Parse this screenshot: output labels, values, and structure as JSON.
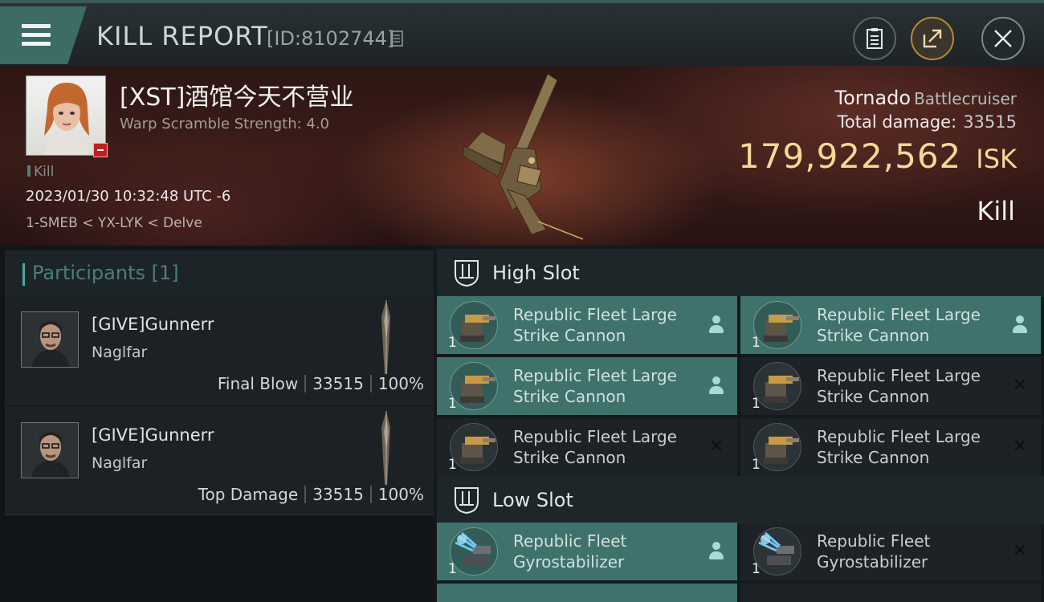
{
  "header": {
    "title": "KILL REPORT",
    "report_id": "[ID:8102744]",
    "buttons": [
      "clipboard-icon",
      "share-icon",
      "close-icon"
    ]
  },
  "victim": {
    "name": "[XST]酒馆今天不营业",
    "scramble": "Warp Scramble Strength: 4.0",
    "tag": "Kill",
    "datetime": "2023/01/30 10:32:48 UTC -6",
    "location": "1-SMEB < YX-LYK < Delve"
  },
  "ship": {
    "name": "Tornado",
    "class": "Battlecruiser",
    "damage_label": "Total damage:",
    "damage_value": "33515",
    "isk_value": "179,922,562",
    "isk_unit": "ISK",
    "result": "Kill"
  },
  "participants": {
    "label": "Participants",
    "count": "[1]",
    "items": [
      {
        "name": "[GIVE]Gunnerr",
        "ship": "Naglfar",
        "role": "Final Blow",
        "damage": "33515",
        "percent": "100%"
      },
      {
        "name": "[GIVE]Gunnerr",
        "ship": "Naglfar",
        "role": "Top Damage",
        "damage": "33515",
        "percent": "100%"
      }
    ]
  },
  "high_slot": {
    "title": "High Slot",
    "modules": [
      {
        "line1": "Republic Fleet Large",
        "line2": "Strike Cannon",
        "qty": "1",
        "status": "fitted"
      },
      {
        "line1": "Republic Fleet Large",
        "line2": "Strike Cannon",
        "qty": "1",
        "status": "fitted"
      },
      {
        "line1": "Republic Fleet Large",
        "line2": "Strike Cannon",
        "qty": "1",
        "status": "fitted"
      },
      {
        "line1": "Republic Fleet Large",
        "line2": "Strike Cannon",
        "qty": "1",
        "status": "destroyed"
      },
      {
        "line1": "Republic Fleet Large",
        "line2": "Strike Cannon",
        "qty": "1",
        "status": "destroyed"
      },
      {
        "line1": "Republic Fleet Large",
        "line2": "Strike Cannon",
        "qty": "1",
        "status": "destroyed"
      }
    ]
  },
  "low_slot": {
    "title": "Low Slot",
    "modules": [
      {
        "line1": "Republic Fleet",
        "line2": "Gyrostabilizer",
        "qty": "1",
        "status": "fitted"
      },
      {
        "line1": "Republic Fleet",
        "line2": "Gyrostabilizer",
        "qty": "1",
        "status": "destroyed"
      }
    ]
  },
  "colors": {
    "accent_teal": "#3f726c",
    "isk_gold": "#f5d89a",
    "kill_red": "#c21f1f"
  }
}
